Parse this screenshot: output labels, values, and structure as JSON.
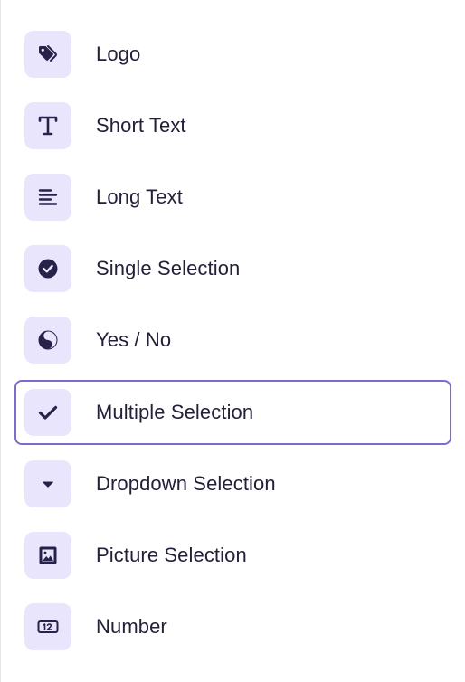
{
  "selected_index": 5,
  "colors": {
    "icon_bg": "#e9e5fc",
    "icon_fg": "#27224a",
    "selected_border": "#7b6cd0",
    "text": "#23203a"
  },
  "fields": [
    {
      "label": "Logo",
      "icon": "tag-icon"
    },
    {
      "label": "Short Text",
      "icon": "text-t-icon"
    },
    {
      "label": "Long Text",
      "icon": "align-left-icon"
    },
    {
      "label": "Single Selection",
      "icon": "check-circle-icon"
    },
    {
      "label": "Yes / No",
      "icon": "yin-yang-icon"
    },
    {
      "label": "Multiple Selection",
      "icon": "check-icon"
    },
    {
      "label": "Dropdown Selection",
      "icon": "caret-down-icon"
    },
    {
      "label": "Picture Selection",
      "icon": "image-icon"
    },
    {
      "label": "Number",
      "icon": "number-box-icon"
    }
  ]
}
